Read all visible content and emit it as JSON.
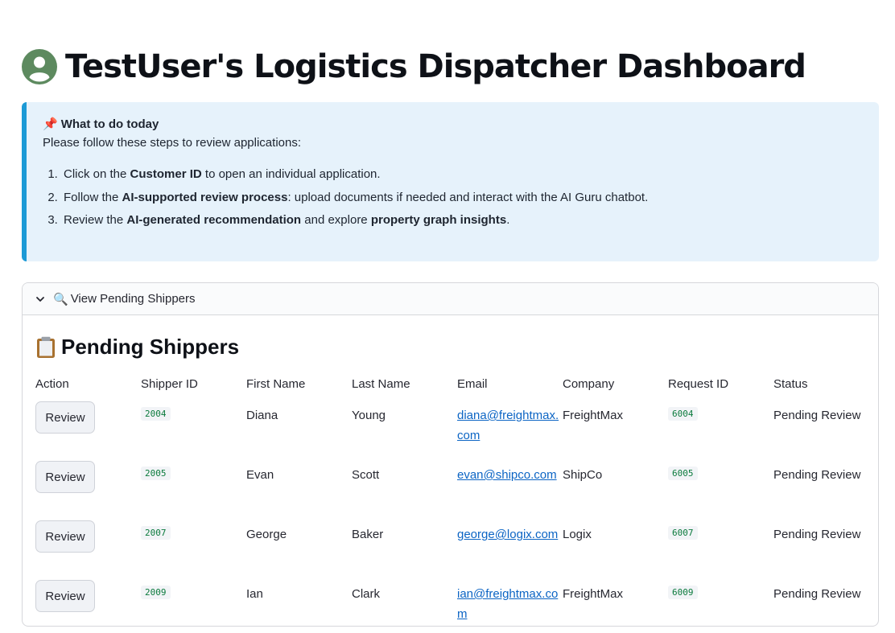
{
  "header": {
    "title": "TestUser's Logistics Dispatcher Dashboard",
    "avatar_icon": "user-avatar-icon",
    "avatar_color": "#5d8a5f"
  },
  "info": {
    "icon": "📌",
    "heading": "What to do today",
    "intro": "Please follow these steps to review applications:",
    "steps": [
      {
        "pre": "Click on the ",
        "bold": "Customer ID",
        "post": " to open an individual application."
      },
      {
        "pre": "Follow the ",
        "bold": "AI-supported review process",
        "post": ": upload documents if needed and interact with the AI Guru chatbot."
      },
      {
        "pre": "Review the ",
        "bold": "AI-generated recommendation",
        "mid": " and explore ",
        "bold2": "property graph insights",
        "post": "."
      }
    ],
    "accent_color": "#1c9ad6",
    "background_color": "#e6f2fb"
  },
  "expander": {
    "chevron_icon": "chevron-down-icon",
    "icon": "🔍",
    "label": "View Pending Shippers"
  },
  "section": {
    "icon": "📋",
    "title": "Pending Shippers"
  },
  "table": {
    "columns": [
      "Action",
      "Shipper ID",
      "First Name",
      "Last Name",
      "Email",
      "Company",
      "Request ID",
      "Status"
    ],
    "rows": [
      {
        "action": "Review",
        "shipper_id": "2004",
        "first_name": "Diana",
        "last_name": "Young",
        "email": "diana@freightmax.com",
        "company": "FreightMax",
        "request_id": "6004",
        "status": "Pending Review"
      },
      {
        "action": "Review",
        "shipper_id": "2005",
        "first_name": "Evan",
        "last_name": "Scott",
        "email": "evan@shipco.com",
        "company": "ShipCo",
        "request_id": "6005",
        "status": "Pending Review"
      },
      {
        "action": "Review",
        "shipper_id": "2007",
        "first_name": "George",
        "last_name": "Baker",
        "email": "george@logix.com",
        "company": "Logix",
        "request_id": "6007",
        "status": "Pending Review"
      },
      {
        "action": "Review",
        "shipper_id": "2009",
        "first_name": "Ian",
        "last_name": "Clark",
        "email": "ian@freightmax.com",
        "company": "FreightMax",
        "request_id": "6009",
        "status": "Pending Review"
      }
    ]
  }
}
